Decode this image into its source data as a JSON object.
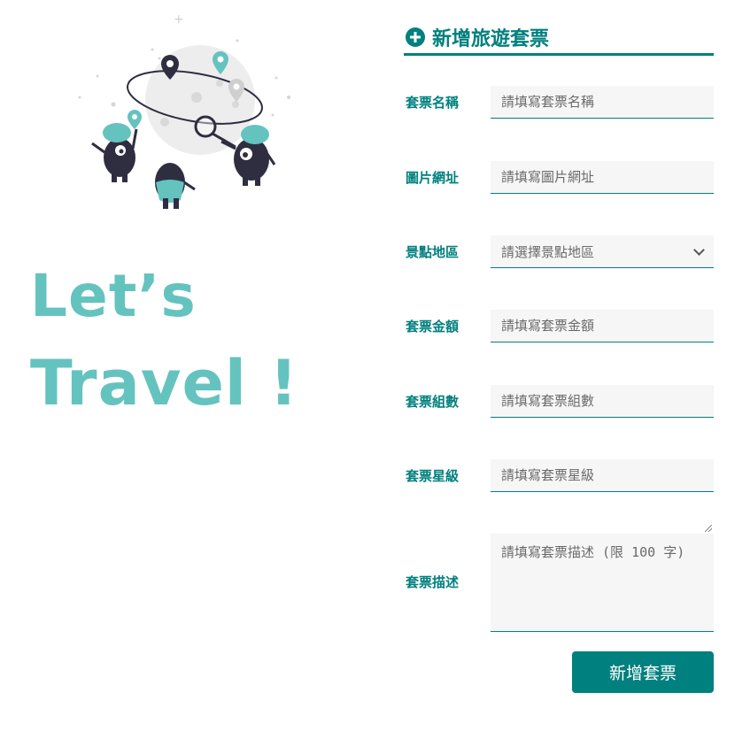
{
  "hero": {
    "line1": "Let’s",
    "line2": "Travel !"
  },
  "form": {
    "title": "新增旅遊套票",
    "fields": [
      {
        "label": "套票名稱",
        "placeholder": "請填寫套票名稱"
      },
      {
        "label": "圖片網址",
        "placeholder": "請填寫圖片網址"
      },
      {
        "label": "景點地區",
        "placeholder": "請選擇景點地區"
      },
      {
        "label": "套票金額",
        "placeholder": "請填寫套票金額"
      },
      {
        "label": "套票組數",
        "placeholder": "請填寫套票組數"
      },
      {
        "label": "套票星級",
        "placeholder": "請填寫套票星級"
      },
      {
        "label": "套票描述",
        "placeholder": "請填寫套票描述 (限 100 字)"
      }
    ],
    "submit_label": "新增套票"
  },
  "colors": {
    "accent": "#00807e",
    "hero_text": "#64c3bf",
    "field_bg": "#f6f6f6",
    "illustration_dark": "#2f2e41"
  },
  "icons": [
    "plus-circle-icon",
    "chevron-down-icon",
    "map-pin-icon",
    "magnifier-icon"
  ]
}
